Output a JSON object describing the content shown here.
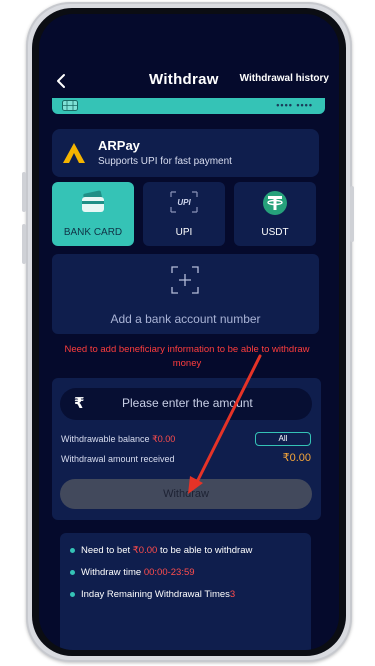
{
  "header": {
    "title": "Withdraw",
    "history_link": "Withdrawal history"
  },
  "card": {
    "number_mask": "•••• ••••"
  },
  "channel": {
    "name": "ARPay",
    "description": "Supports UPI for fast payment"
  },
  "methods": [
    {
      "label": "BANK CARD",
      "icon": "bank-card-icon",
      "selected": true
    },
    {
      "label": "UPI",
      "icon": "upi-icon",
      "selected": false
    },
    {
      "label": "USDT",
      "icon": "usdt-icon",
      "selected": false
    }
  ],
  "add_account": {
    "label": "Add a bank account number"
  },
  "warning": "Need to add beneficiary information to be able to withdraw money",
  "amount": {
    "currency_symbol": "₹",
    "placeholder": "Please enter the amount",
    "withdrawable_label": "Withdrawable balance ",
    "withdrawable_value": "₹0.00",
    "all_label": "All",
    "received_label": "Withdrawal amount received",
    "received_value": "₹0.00",
    "submit_label": "Withdraw"
  },
  "info": {
    "bet_prefix": "Need to bet ",
    "bet_value": "₹0.00",
    "bet_suffix": " to be able to withdraw",
    "time_label": "Withdraw time ",
    "time_value": "00:00-23:59",
    "remaining_label": "Inday Remaining Withdrawal Times",
    "remaining_value": "3"
  },
  "colors": {
    "background": "#050a2c",
    "panel": "#0f1e4d",
    "accent": "#35c3b6",
    "warning": "#ff3d3d",
    "amount": "#f6a63a"
  }
}
